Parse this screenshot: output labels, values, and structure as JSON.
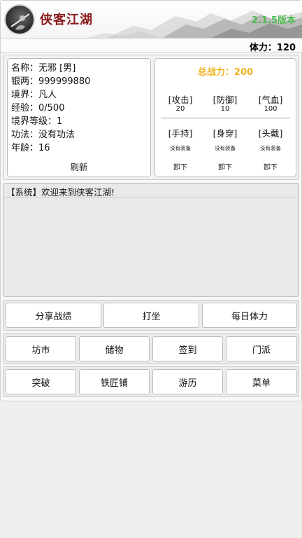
{
  "header": {
    "app_title": "侠客江湖",
    "version": "2.1.5版本",
    "logo_icon": "swordsman-logo-icon",
    "stamina": "体力：120"
  },
  "character": {
    "lines": [
      "名称：无邪 [男]",
      "银两：999999880",
      "境界：凡人",
      "经验：0/500",
      "境界等级：1",
      "功法：没有功法",
      "年龄：16"
    ],
    "refresh_label": "刷新"
  },
  "stats": {
    "power": "总战力：200",
    "attributes": [
      {
        "label": "[攻击]",
        "value": "20"
      },
      {
        "label": "[防御]",
        "value": "10"
      },
      {
        "label": "[气血]",
        "value": "100"
      }
    ],
    "equipment": [
      {
        "label": "[手持]",
        "status": "没有装备",
        "action": "卸下"
      },
      {
        "label": "[身穿]",
        "status": "没有装备",
        "action": "卸下"
      },
      {
        "label": "[头戴]",
        "status": "没有装备",
        "action": "卸下"
      }
    ]
  },
  "log": {
    "messages": [
      "【系统】欢迎来到侠客江湖!"
    ]
  },
  "buttons": {
    "row1": [
      "分享战绩",
      "打坐",
      "每日体力"
    ],
    "row2": [
      "坊市",
      "储物",
      "签到",
      "门派"
    ],
    "row3": [
      "突破",
      "铁匠铺",
      "游历",
      "菜单"
    ]
  },
  "colors": {
    "title": "#8b1a1a",
    "version": "#4cbb4f",
    "power": "#f0b322",
    "background": "#efefef"
  }
}
